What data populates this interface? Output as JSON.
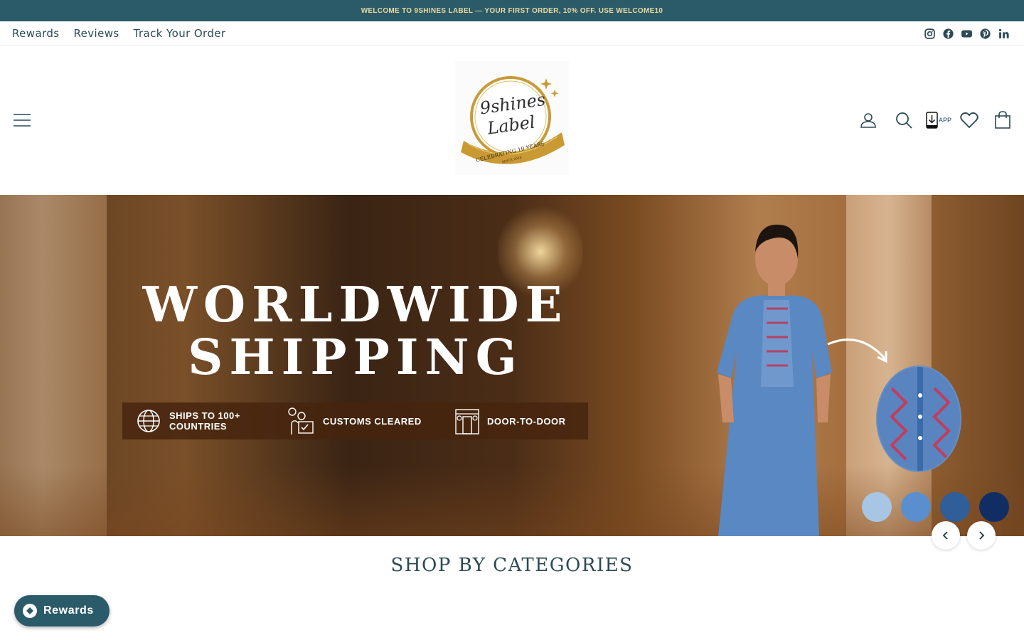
{
  "announcement": {
    "text": "WELCOME TO 9SHINES LABEL — YOUR FIRST ORDER, 10% OFF. USE WELCOME10"
  },
  "utility_nav": {
    "links": [
      "Rewards",
      "Reviews",
      "Track Your Order"
    ],
    "social_icons": [
      "instagram-icon",
      "facebook-icon",
      "youtube-icon",
      "pinterest-icon",
      "linkedin-icon"
    ]
  },
  "header": {
    "logo": {
      "brand": "9shines Label",
      "tagline": "CELEBRATING 10 YEARS",
      "since": "SINCE 2016"
    },
    "icons": [
      "account-icon",
      "search-icon",
      "app-download-icon",
      "wishlist-icon",
      "cart-icon"
    ],
    "app_label": "APP"
  },
  "hero": {
    "title_line1": "WORLDWIDE",
    "title_line2": "SHIPPING",
    "features": [
      {
        "icon": "globe-icon",
        "line1": "SHIPS TO 100+",
        "line2": "COUNTRIES"
      },
      {
        "icon": "customs-icon",
        "line1": "CUSTOMS CLEARED",
        "line2": ""
      },
      {
        "icon": "door-icon",
        "line1": "DOOR-TO-DOOR",
        "line2": ""
      }
    ],
    "swatch_colors": [
      "#a8c6e4",
      "#5a8fcf",
      "#2f5e98",
      "#102e63"
    ]
  },
  "carousel": {
    "prev_icon": "chevron-left-icon",
    "next_icon": "chevron-right-icon"
  },
  "section": {
    "title": "SHOP BY CATEGORIES"
  },
  "rewards_button": {
    "label": "Rewards"
  },
  "colors": {
    "brand_teal": "#2b5a68",
    "announcement_text": "#e8d9a0",
    "text": "#2c4a55"
  }
}
